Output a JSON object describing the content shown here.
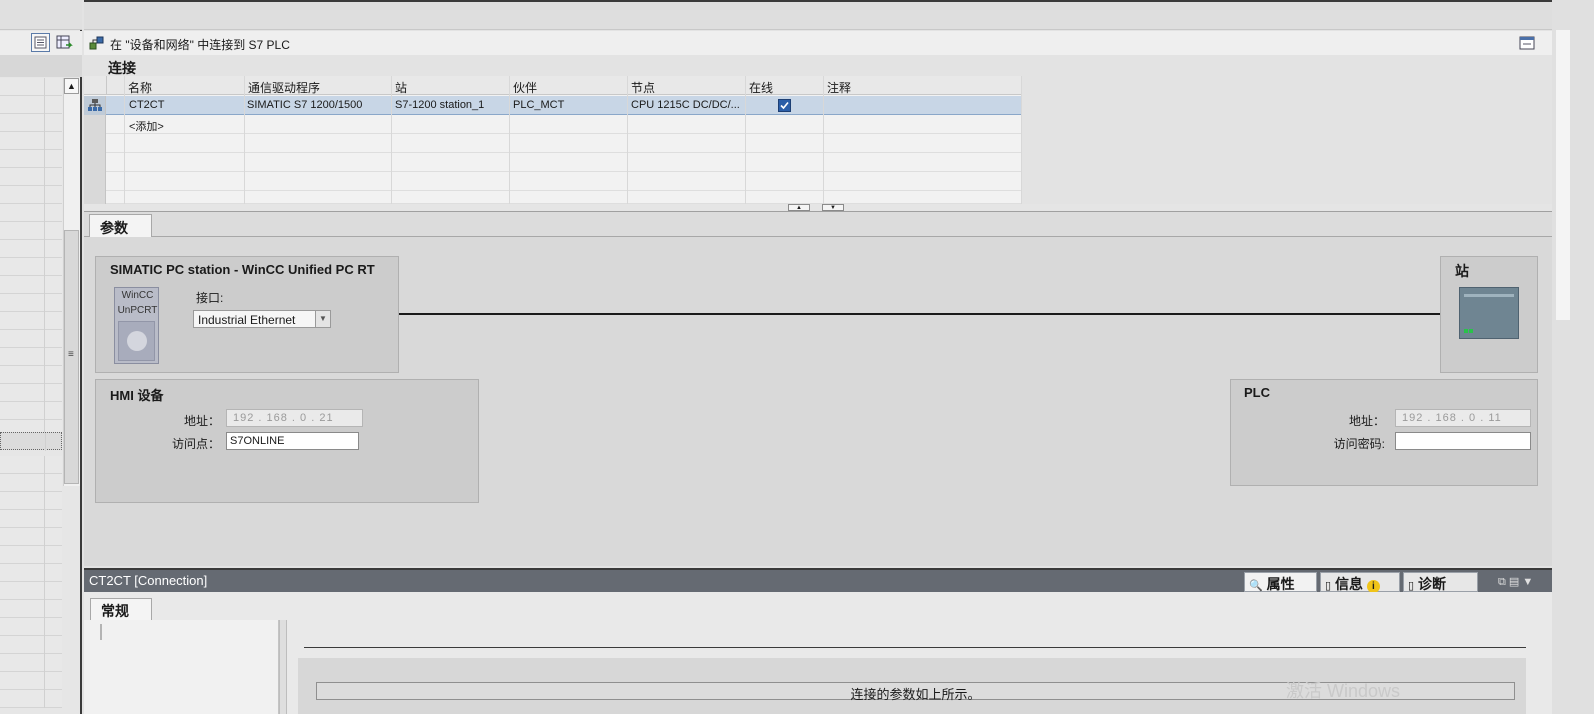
{
  "toolbar": {
    "title": "在 \"设备和网络\" 中连接到 S7 PLC"
  },
  "section": {
    "title": "连接"
  },
  "grid": {
    "headers": [
      "名称",
      "通信驱动程序",
      "站",
      "伙伴",
      "节点",
      "在线",
      "注释"
    ],
    "rows": [
      {
        "name": "CT2CT",
        "driver": "SIMATIC S7 1200/1500",
        "station": "S7-1200 station_1",
        "partner": "PLC_MCT",
        "node": "CPU 1215C DC/DC/...",
        "online": true,
        "comment": ""
      }
    ],
    "add_label": "<添加>"
  },
  "params": {
    "tab_label": "参数",
    "pc_station": {
      "title": "SIMATIC PC station - WinCC Unified PC RT",
      "icon_line1": "WinCC",
      "icon_line2": "UnPCRT",
      "interface_label": "接口:",
      "interface_value": "Industrial Ethernet"
    },
    "station": {
      "title": "站"
    },
    "hmi": {
      "title": "HMI 设备",
      "address_label": "地址：",
      "address": "192 . 168 . 0   . 21",
      "access_point_label": "访问点：",
      "access_point": "S7ONLINE"
    },
    "plc": {
      "title": "PLC",
      "address_label": "地址：",
      "address": "192 . 168 . 0   . 11",
      "password_label": "访问密码:",
      "password": ""
    }
  },
  "bottom": {
    "title": "CT2CT [Connection]",
    "tabs": {
      "properties": "属性",
      "info": "信息",
      "diagnostics": "诊断"
    },
    "general_tab": "常规",
    "message": "连接的参数如上所示。",
    "watermark": "激活 Windows"
  },
  "colors": {
    "selected_row": "#c8d6e6",
    "bottom_header": "#656a72",
    "plc_body": "#6f8592"
  },
  "icons": [
    "list-view-icon",
    "grid-view-icon",
    "connect-icon",
    "network-device-icon",
    "checkbox-checked-icon",
    "dropdown-arrow-icon",
    "scroll-up-icon",
    "splitter-icon",
    "properties-icon",
    "info-icon",
    "diagnostics-icon",
    "window-float-icon"
  ]
}
